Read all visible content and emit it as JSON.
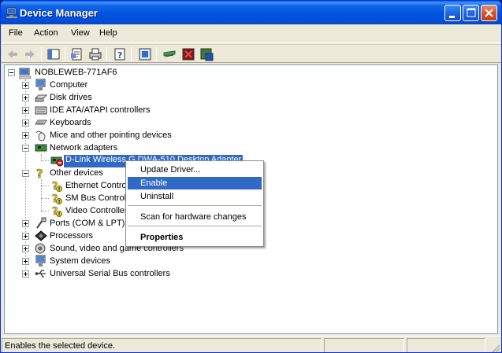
{
  "window": {
    "title": "Device Manager",
    "icon": "device-manager-icon"
  },
  "menu": {
    "items": [
      "File",
      "Action",
      "View",
      "Help"
    ]
  },
  "toolbar": {
    "buttons": [
      "back-icon",
      "forward-icon",
      "show-hide-tree-icon",
      "properties-icon",
      "print-icon",
      "help-icon",
      "update-driver-icon",
      "scan-hardware-icon",
      "uninstall-icon",
      "disable-icon"
    ]
  },
  "tree": {
    "root": "NOBLEWEB-771AF6",
    "categories": [
      {
        "label": "Computer",
        "icon": "computer-icon"
      },
      {
        "label": "Disk drives",
        "icon": "disk-drive-icon"
      },
      {
        "label": "IDE ATA/ATAPI controllers",
        "icon": "ide-controller-icon"
      },
      {
        "label": "Keyboards",
        "icon": "keyboard-icon"
      },
      {
        "label": "Mice and other pointing devices",
        "icon": "mouse-icon"
      },
      {
        "label": "Network adapters",
        "icon": "network-adapter-icon"
      },
      {
        "label": "D-Link Wireless G DWA-510 Desktop Adapter",
        "icon": "network-card-disabled-icon"
      },
      {
        "label": "Other devices",
        "icon": "unknown-device-icon"
      },
      {
        "label": "Ethernet Contro",
        "icon": "warning-device-icon"
      },
      {
        "label": "SM Bus Controlle",
        "icon": "warning-device-icon"
      },
      {
        "label": "Video Controller",
        "icon": "warning-device-icon"
      },
      {
        "label": "Ports (COM & LPT)",
        "icon": "port-icon"
      },
      {
        "label": "Processors",
        "icon": "processor-icon"
      },
      {
        "label": "Sound, video and game controllers",
        "icon": "sound-icon"
      },
      {
        "label": "System devices",
        "icon": "system-device-icon"
      },
      {
        "label": "Universal Serial Bus controllers",
        "icon": "usb-icon"
      }
    ]
  },
  "context_menu": {
    "items": [
      "Update Driver...",
      "Enable",
      "Uninstall",
      "Scan for hardware changes",
      "Properties"
    ],
    "highlighted": "Enable"
  },
  "status": {
    "text": "Enables the selected device."
  },
  "colors": {
    "titlebar": "#0053e0",
    "selection": "#316ac5",
    "chrome": "#ece9d8"
  }
}
